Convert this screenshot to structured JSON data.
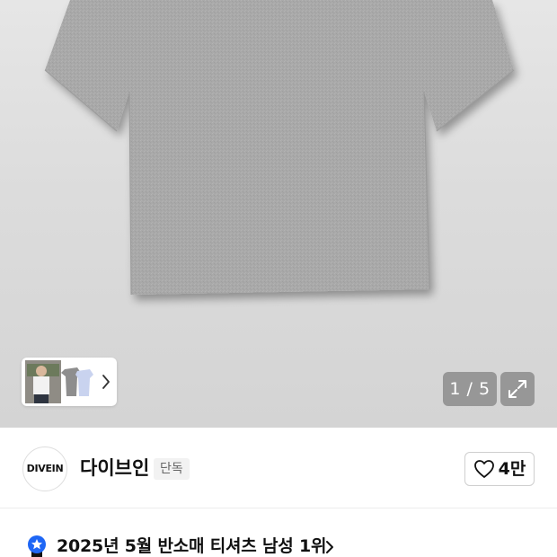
{
  "gallery": {
    "counter": "1 / 5",
    "shirt_color": "#a9a9a9"
  },
  "brand": {
    "logo_text": "DIVEIN",
    "name": "다이브인",
    "badge": "단독",
    "like_count": "4만"
  },
  "ranking": {
    "text": "2025년 5월 반소매 티셔츠 남성 1위"
  },
  "colors": {
    "accent": "#1e66f5",
    "text": "#111111"
  }
}
